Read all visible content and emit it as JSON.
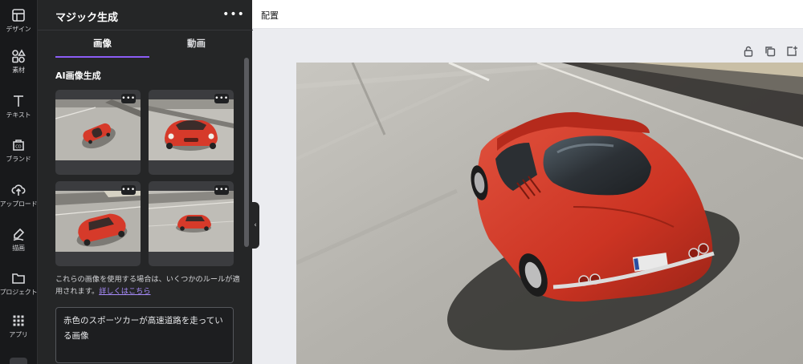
{
  "rail": {
    "items": [
      {
        "label": "デザイン",
        "icon": "layout-icon"
      },
      {
        "label": "素材",
        "icon": "shapes-icon"
      },
      {
        "label": "テキスト",
        "icon": "text-icon"
      },
      {
        "label": "ブランド",
        "icon": "brand-icon"
      },
      {
        "label": "アップロード",
        "icon": "upload-icon"
      },
      {
        "label": "描画",
        "icon": "draw-icon"
      },
      {
        "label": "プロジェクト",
        "icon": "folder-icon"
      },
      {
        "label": "アプリ",
        "icon": "apps-icon"
      }
    ]
  },
  "panel": {
    "title": "マジック生成",
    "more": "•••",
    "tabs": [
      {
        "label": "画像",
        "active": true
      },
      {
        "label": "動画",
        "active": false
      }
    ],
    "section_title": "AI画像生成",
    "thumb_more": "•••",
    "notice_text": "これらの画像を使用する場合は、いくつかのルールが適用されます。",
    "notice_link": "詳しくはこちら",
    "prompt_text": "赤色のスポーツカーが高速道路を走っている画像",
    "collapse_glyph": "‹"
  },
  "topbar": {
    "label": "配置"
  },
  "colors": {
    "accent": "#8b5cf6",
    "car_red": "#d63a2a",
    "panel_bg": "#252627",
    "rail_bg": "#18191b"
  }
}
